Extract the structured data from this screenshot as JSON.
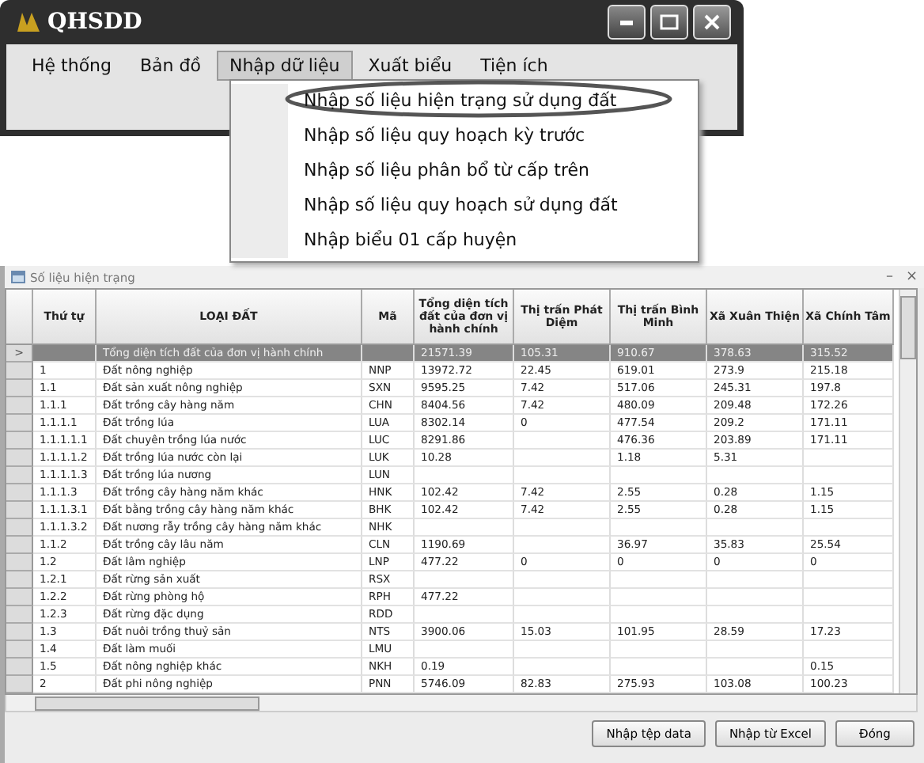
{
  "window": {
    "title": "QHSDD"
  },
  "menu": [
    {
      "label": "Hệ thống",
      "selected": false
    },
    {
      "label": "Bản đồ",
      "selected": false
    },
    {
      "label": "Nhập dữ liệu",
      "selected": true
    },
    {
      "label": "Xuất biểu",
      "selected": false
    },
    {
      "label": "Tiện ích",
      "selected": false
    }
  ],
  "dropdown": [
    {
      "label": "Nhập số liệu hiện trạng sử dụng đất",
      "highlighted": true
    },
    {
      "label": "Nhập số liệu quy hoạch kỳ trước",
      "highlighted": false
    },
    {
      "label": "Nhập số liệu phân bổ từ cấp trên",
      "highlighted": false
    },
    {
      "label": "Nhập số liệu quy hoạch sử dụng đất",
      "highlighted": false
    },
    {
      "label": "Nhập biểu 01 cấp huyện",
      "highlighted": false
    }
  ],
  "data_window": {
    "title": "Số liệu hiện trạng",
    "minimize": "–",
    "close": "×"
  },
  "table": {
    "columns": [
      "Thứ tự",
      "LOẠI ĐẤT",
      "Mã",
      "Tổng diện tích đất của đơn vị hành chính",
      "Thị trấn Phát Diệm",
      "Thị trấn Bình Minh",
      "Xã Xuân Thiện",
      "Xã Chính Tâm"
    ],
    "current_marker": ">",
    "rows": [
      {
        "selected": true,
        "name": "Tổng diện tích đất của đơn vị hành chính",
        "total": "21571.39",
        "phat_diem": "105.31",
        "binh_minh": "910.67",
        "xuan_thien": "378.63",
        "chinh_tam": "315.52"
      },
      {
        "selected": false,
        "stt": "1",
        "name": "Đất nông nghiệp",
        "code": "NNP",
        "total": "13972.72",
        "phat_diem": "22.45",
        "binh_minh": "619.01",
        "xuan_thien": "273.9",
        "chinh_tam": "215.18"
      },
      {
        "selected": false,
        "stt": "1.1",
        "name": "Đất sản xuất nông nghiệp",
        "code": "SXN",
        "total": "9595.25",
        "phat_diem": "7.42",
        "binh_minh": "517.06",
        "xuan_thien": "245.31",
        "chinh_tam": "197.8"
      },
      {
        "selected": false,
        "stt": "1.1.1",
        "name": "Đất trồng cây hàng năm",
        "code": "CHN",
        "total": "8404.56",
        "phat_diem": "7.42",
        "binh_minh": "480.09",
        "xuan_thien": "209.48",
        "chinh_tam": "172.26"
      },
      {
        "selected": false,
        "stt": "1.1.1.1",
        "name": "Đất trồng lúa",
        "code": "LUA",
        "total": "8302.14",
        "phat_diem": "0",
        "binh_minh": "477.54",
        "xuan_thien": "209.2",
        "chinh_tam": "171.11"
      },
      {
        "selected": false,
        "stt": "1.1.1.1.1",
        "name": "Đất chuyên trồng lúa nước",
        "code": "LUC",
        "total": "8291.86",
        "binh_minh": "476.36",
        "xuan_thien": "203.89",
        "chinh_tam": "171.11"
      },
      {
        "selected": false,
        "stt": "1.1.1.1.2",
        "name": "Đất trồng lúa nước còn lại",
        "code": "LUK",
        "total": "10.28",
        "binh_minh": "1.18",
        "xuan_thien": "5.31"
      },
      {
        "selected": false,
        "stt": "1.1.1.1.3",
        "name": "Đất trồng lúa nương",
        "code": "LUN"
      },
      {
        "selected": false,
        "stt": "1.1.1.3",
        "name": "Đất trồng cây hàng năm khác",
        "code": "HNK",
        "total": "102.42",
        "phat_diem": "7.42",
        "binh_minh": "2.55",
        "xuan_thien": "0.28",
        "chinh_tam": "1.15"
      },
      {
        "selected": false,
        "stt": "1.1.1.3.1",
        "name": "Đất bằng trồng cây hàng năm khác",
        "code": "BHK",
        "total": "102.42",
        "phat_diem": "7.42",
        "binh_minh": "2.55",
        "xuan_thien": "0.28",
        "chinh_tam": "1.15"
      },
      {
        "selected": false,
        "stt": "1.1.1.3.2",
        "name": "Đất nương rẫy trồng cây hàng năm khác",
        "code": "NHK"
      },
      {
        "selected": false,
        "stt": "1.1.2",
        "name": "Đất trồng cây lâu năm",
        "code": "CLN",
        "total": "1190.69",
        "binh_minh": "36.97",
        "xuan_thien": "35.83",
        "chinh_tam": "25.54"
      },
      {
        "selected": false,
        "stt": "1.2",
        "name": "Đất lâm nghiệp",
        "code": "LNP",
        "total": "477.22",
        "phat_diem": "0",
        "binh_minh": "0",
        "xuan_thien": "0",
        "chinh_tam": "0"
      },
      {
        "selected": false,
        "stt": "1.2.1",
        "name": "Đất rừng sản xuất",
        "code": "RSX"
      },
      {
        "selected": false,
        "stt": "1.2.2",
        "name": "Đất rừng phòng hộ",
        "code": "RPH",
        "total": "477.22"
      },
      {
        "selected": false,
        "stt": "1.2.3",
        "name": "Đất rừng đặc dụng",
        "code": "RDD"
      },
      {
        "selected": false,
        "stt": "1.3",
        "name": "Đất nuôi trồng thuỷ sản",
        "code": "NTS",
        "total": "3900.06",
        "phat_diem": "15.03",
        "binh_minh": "101.95",
        "xuan_thien": "28.59",
        "chinh_tam": "17.23"
      },
      {
        "selected": false,
        "stt": "1.4",
        "name": "Đất làm muối",
        "code": "LMU"
      },
      {
        "selected": false,
        "stt": "1.5",
        "name": "Đất nông nghiệp khác",
        "code": "NKH",
        "total": "0.19",
        "chinh_tam": "0.15"
      },
      {
        "selected": false,
        "stt": "2",
        "name": "Đất phi nông nghiệp",
        "code": "PNN",
        "total": "5746.09",
        "phat_diem": "82.83",
        "binh_minh": "275.93",
        "xuan_thien": "103.08",
        "chinh_tam": "100.23"
      }
    ]
  },
  "buttons": [
    "Nhập tệp data",
    "Nhập từ Excel",
    "Đóng"
  ]
}
